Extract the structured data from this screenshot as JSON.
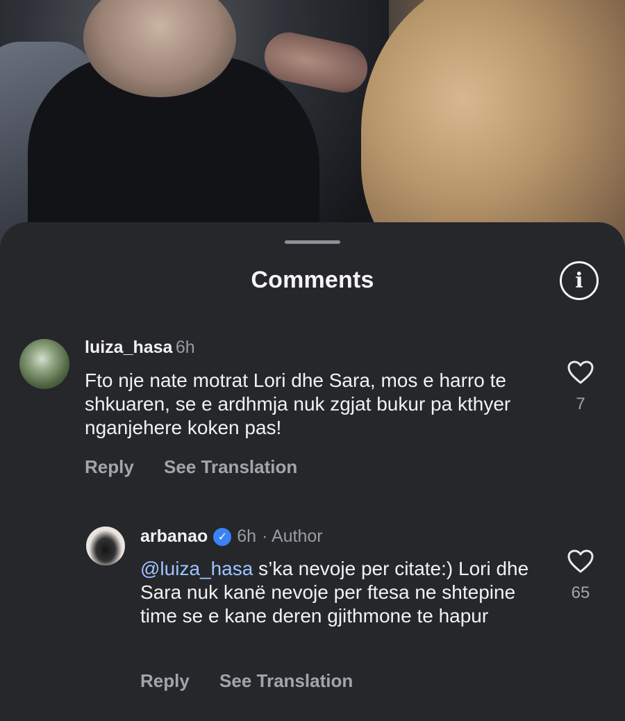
{
  "sheet": {
    "title": "Comments",
    "info_icon": "info-icon"
  },
  "comments": [
    {
      "username": "luiza_hasa",
      "time": "6h",
      "text": "Fto nje nate motrat Lori dhe Sara, mos e harro te shkuaren, se e ardhmja nuk zgjat bukur pa kthyer nganjehere koken pas!",
      "likes": "7",
      "reply_label": "Reply",
      "translate_label": "See Translation"
    },
    {
      "username": "arbanao",
      "verified": true,
      "time": "6h",
      "author_tag": "· Author",
      "mention": "@luiza_hasa",
      "text": " s’ka nevoje per citate:) Lori dhe Sara nuk kanë nevoje per ftesa ne shtepine time se e kane deren gjithmone te hapur",
      "likes": "65",
      "reply_label": "Reply",
      "translate_label": "See Translation"
    }
  ],
  "colors": {
    "sheet_bg": "#25272b",
    "mention": "#9fc3ff",
    "verified": "#3b82f6"
  }
}
